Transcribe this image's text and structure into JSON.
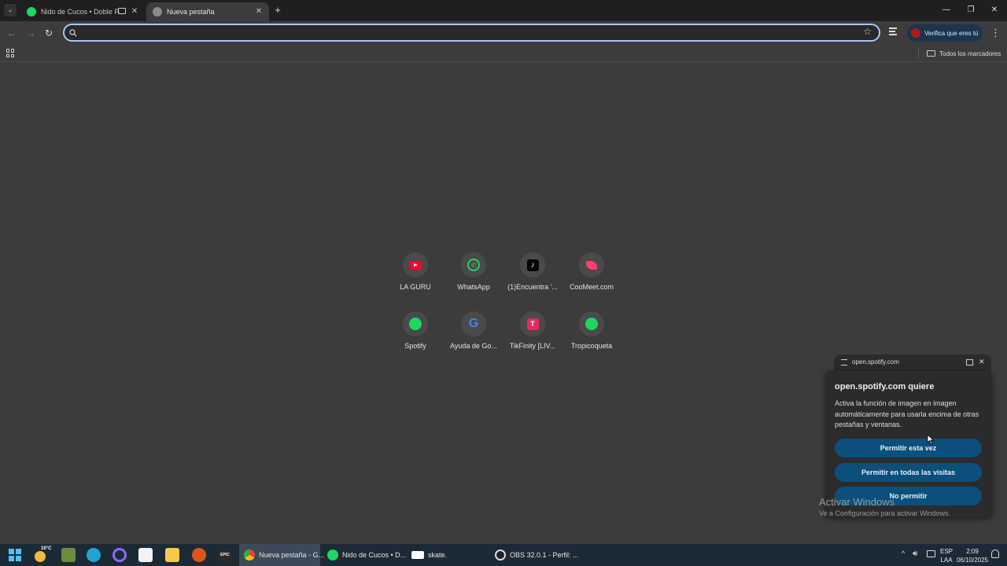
{
  "tabs": [
    {
      "title": "Nido de Cucos • Doble Por",
      "close": "✕"
    },
    {
      "title": "Nueva pestaña",
      "close": "✕"
    }
  ],
  "new_tab_symbol": "+",
  "window_controls": {
    "minimize": "—",
    "restore": "❐",
    "close": "✕"
  },
  "toolbar": {
    "back": "←",
    "forward": "→",
    "reload": "↻",
    "omnibox_value": "",
    "profile_label": "Verifica que eres tú",
    "menu": "⋮"
  },
  "bookmarks": {
    "all_bookmarks": "Todos los marcadores"
  },
  "shortcuts": [
    {
      "label": "LA GURU",
      "icon": "youtube-icon"
    },
    {
      "label": "WhatsApp",
      "icon": "whatsapp-icon"
    },
    {
      "label": "(1)Encuentra '...",
      "icon": "tiktok-icon"
    },
    {
      "label": "CooMeet.com",
      "icon": "coomeet-icon"
    },
    {
      "label": "Spotify",
      "icon": "spotify-icon"
    },
    {
      "label": "Ayuda de Go...",
      "icon": "google-icon"
    },
    {
      "label": "TikFinity [LIV...",
      "icon": "tikfinity-icon"
    },
    {
      "label": "Tropicoqueta",
      "icon": "spotify-icon"
    }
  ],
  "pip": {
    "origin": "open.spotify.com"
  },
  "permission_prompt": {
    "title": "open.spotify.com quiere",
    "body": "Activa la función de imagen en imagen automáticamente para usarla encima de otras pestañas y ventanas.",
    "allow_once": "Permitir esta vez",
    "allow_always": "Permitir en todas las visitas",
    "deny": "No permitir"
  },
  "watermark": {
    "title": "Activar Windows",
    "subtitle": "Ve a Configuración para activar Windows."
  },
  "taskbar": {
    "temperature": "10°C",
    "epic": "EPIC",
    "apps": [
      {
        "label": "Nueva pestaña - G...",
        "icon": "chrome-icon"
      },
      {
        "label": "Nido de Cucos • D...",
        "icon": "spotify-icon"
      },
      {
        "label": "skate.",
        "icon": "skate-icon"
      },
      {
        "label": "OBS 32.0.1 - Perfil: ...",
        "icon": "obs-icon"
      }
    ],
    "language_top": "ESP",
    "language_bottom": "LAA",
    "time": "2:09",
    "date": "06/10/2025"
  },
  "colors": {
    "accent": "#a8c7fa",
    "spotify": "#1ed760",
    "youtube": "#ff0033",
    "prompt_button": "#0b4f7a"
  }
}
